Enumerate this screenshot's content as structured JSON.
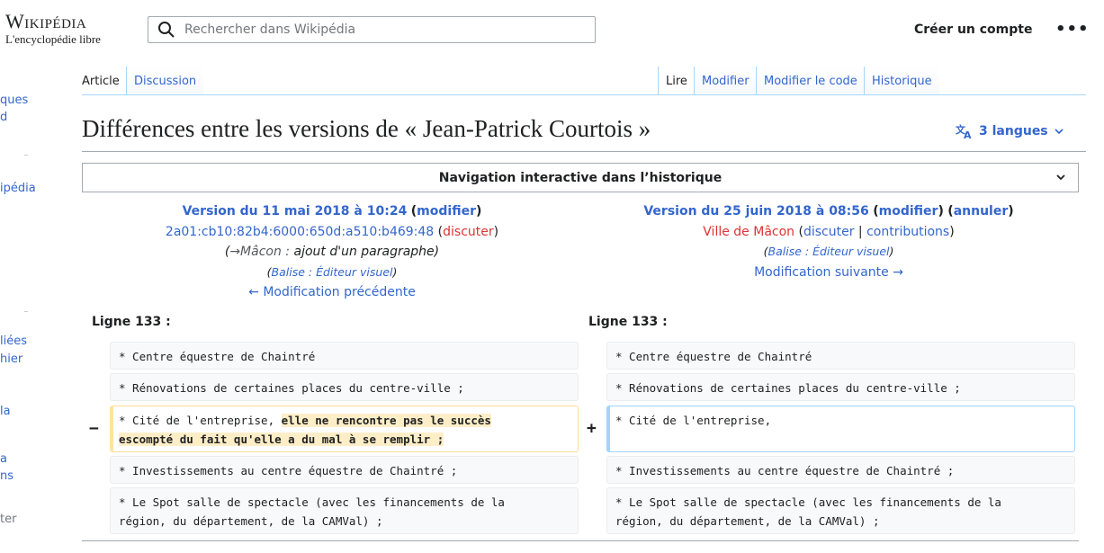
{
  "header": {
    "logo_word": "Wikipédia",
    "logo_tagline": "L'encyclopédie libre",
    "search_placeholder": "Rechercher dans Wikipédia",
    "create_account": "Créer un compte",
    "more_menu": "•••"
  },
  "sidebar": {
    "fragments": [
      "ques",
      "d",
      "ipédia",
      "liées",
      "hier",
      "la",
      "a",
      "ns",
      "ter"
    ]
  },
  "tabs": {
    "left": [
      "Article",
      "Discussion"
    ],
    "right": [
      "Lire",
      "Modifier",
      "Modifier le code",
      "Historique"
    ]
  },
  "page": {
    "title": "Différences entre les versions de « Jean-Patrick Courtois »",
    "languages": "3 langues",
    "history_nav": "Navigation interactive dans l’historique"
  },
  "left_version": {
    "title": "Version du 11 mai 2018 à 10:24",
    "modify": "modifier",
    "user": "2a01:cb10:82b4:6000:650d:a510:b469:48",
    "talk": "discuter",
    "summary_section": "→Mâcon :",
    "summary_text": "ajout d'un paragraphe",
    "tag_label": "Balise :",
    "tag_value": "Éditeur visuel",
    "nav": "← Modification précédente"
  },
  "right_version": {
    "title": "Version du 25 juin 2018 à 08:56",
    "modify": "modifier",
    "undo": "annuler",
    "user": "Ville de Mâcon",
    "talk": "discuter",
    "contribs": "contributions",
    "tag_label": "Balise :",
    "tag_value": "Éditeur visuel",
    "nav": "Modification suivante →"
  },
  "diff": {
    "left_header": "Ligne 133 :",
    "right_header": "Ligne 133 :",
    "minus": "−",
    "plus": "+",
    "rows": [
      "* Centre équestre de Chaintré",
      "* Rénovations de certaines places du centre-ville ;",
      "* Investissements au centre équestre de Chaintré ;"
    ],
    "changed_left_prefix": "* Cité de l'entreprise, ",
    "changed_left_removed_1": "elle ne rencontre pas le succès",
    "changed_left_removed_2": "escompté du fait qu'elle a du mal à se remplir ;",
    "changed_right": "* Cité de l'entreprise,",
    "spot_line_1": "* Le Spot salle de spectacle (avec les financements de la",
    "spot_line_2": "région, du département, de la CAMVal) ;"
  },
  "colors": {
    "link": "#3366cc",
    "redlink": "#dd3333",
    "removed_highlight": "#feeec8",
    "added_border": "#a3d3ff",
    "removed_border": "#ffe49c"
  }
}
